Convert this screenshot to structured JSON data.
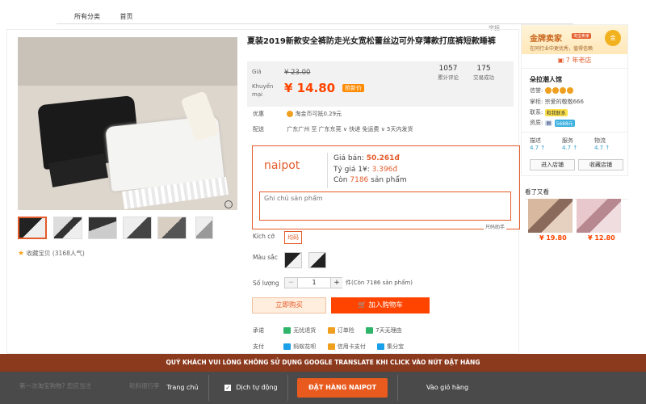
{
  "nav": {
    "items": [
      "所有分类",
      "首页"
    ]
  },
  "report": "举报",
  "product": {
    "title": "夏装2019新款安全裤防走光女宽松蕾丝边可外穿薄款打底裤短款睡裤",
    "price_label": "Giá",
    "old_price": "¥ 23.00",
    "promo_label": "Khuyến mại",
    "new_price": "¥ 14.80",
    "price_tag": "抢新价",
    "stats": [
      {
        "num": "1057",
        "label": "累计评论"
      },
      {
        "num": "175",
        "label": "交易成功"
      }
    ],
    "youhui_label": "优惠",
    "youhui_value": "淘金币可抵0.29元",
    "delivery_label": "配送",
    "delivery_value": "广东广州 至  广东东莞 ∨  快递 免运费 ∨  5天内发货",
    "favorite": "收藏宝贝 (3168人气)"
  },
  "naipot": {
    "logo": "naipot",
    "price_label": "Giá bán:",
    "price_value": "50.261đ",
    "rate_label": "Tỷ giá 1¥:",
    "rate_value": "3.396đ",
    "stock_prefix": "Còn",
    "stock_value": "7186",
    "stock_suffix": "sản phẩm",
    "note_placeholder": "Ghi chú sản phẩm",
    "corner_note": "尺码助手"
  },
  "options": {
    "size_label": "Kích cỡ",
    "size_value": "均码",
    "color_label": "Màu sắc",
    "qty_label": "Số lượng",
    "qty_value": "1",
    "qty_minus": "−",
    "qty_plus": "+",
    "qty_stock": "件(Còn 7186 sản phẩm)"
  },
  "actions": {
    "buy_now": "立即购买",
    "add_cart": "加入购物车"
  },
  "promise": {
    "promise_label": "承诺",
    "items": [
      "无忧退货",
      "订单险",
      "7天无理由"
    ],
    "pay_label": "支付",
    "pay_items": [
      "蚂蚁花呗",
      "信用卡支付",
      "集分宝"
    ]
  },
  "seller": {
    "gold_title": "金牌卖家",
    "gold_tag": "淘宝卖家",
    "gold_sub": "在同行业中更优秀，值得信赖",
    "medal": "金",
    "years": "7 年老店",
    "shop_name": "朵拉潮人馆",
    "credit_label": "信誉:",
    "owner_label": "掌柜:",
    "owner_value": "宗爱的敬敬666",
    "contact_label": "联系:",
    "contact_value": "和我联系",
    "qual_label": "资质:",
    "qual_value": "5688元",
    "ratings": [
      {
        "label": "描述",
        "value": "4.7 ↑"
      },
      {
        "label": "服务",
        "value": "4.7 ↑"
      },
      {
        "label": "物流",
        "value": "4.7 ↑"
      }
    ],
    "enter_shop": "进入店铺",
    "fav_shop": "收藏店铺"
  },
  "seen": {
    "title": "看了又看",
    "prices": [
      "¥ 19.80",
      "¥ 12.80"
    ]
  },
  "footer": {
    "notice": "QUÝ KHÁCH VUI LÒNG KHÔNG SỬ DỤNG GOOGLE TRANSLATE KHI CLICK VÀO NÚT ĐẶT HÀNG",
    "home": "Trang chủ",
    "auto_translate": "Dịch tự động",
    "order_button": "ĐẶT HÀNG NAIPOT",
    "cart": "Vào giỏ hàng",
    "bg_left": "第一次淘宝购物? 您应当注",
    "bg_mid": "轮料很行李"
  }
}
